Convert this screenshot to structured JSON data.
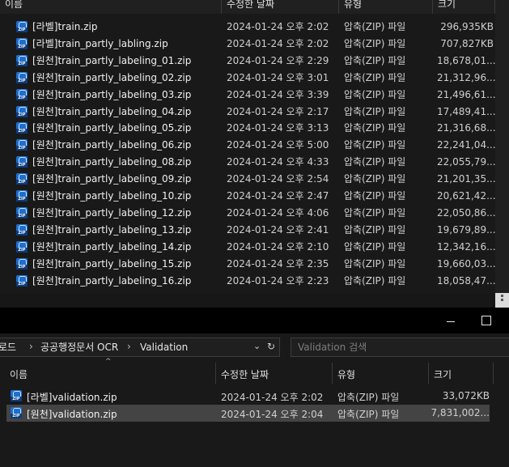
{
  "top_window": {
    "columns": {
      "name": "이름",
      "date": "수정한 날짜",
      "type": "유형",
      "size": "크기"
    },
    "files": [
      {
        "name": "[라벨]train.zip",
        "date": "2024-01-24 오후 2:02",
        "type": "압축(ZIP) 파일",
        "size": "296,935KB"
      },
      {
        "name": "[라벨]train_partly_labling.zip",
        "date": "2024-01-24 오후 2:02",
        "type": "압축(ZIP) 파일",
        "size": "707,827KB"
      },
      {
        "name": "[원천]train_partly_labeling_01.zip",
        "date": "2024-01-24 오후 2:29",
        "type": "압축(ZIP) 파일",
        "size": "18,678,01..."
      },
      {
        "name": "[원천]train_partly_labeling_02.zip",
        "date": "2024-01-24 오후 3:01",
        "type": "압축(ZIP) 파일",
        "size": "21,312,96..."
      },
      {
        "name": "[원천]train_partly_labeling_03.zip",
        "date": "2024-01-24 오후 3:39",
        "type": "압축(ZIP) 파일",
        "size": "21,496,61..."
      },
      {
        "name": "[원천]train_partly_labeling_04.zip",
        "date": "2024-01-24 오후 2:17",
        "type": "압축(ZIP) 파일",
        "size": "17,489,41..."
      },
      {
        "name": "[원천]train_partly_labeling_05.zip",
        "date": "2024-01-24 오후 3:13",
        "type": "압축(ZIP) 파일",
        "size": "21,316,68..."
      },
      {
        "name": "[원천]train_partly_labeling_06.zip",
        "date": "2024-01-24 오후 5:00",
        "type": "압축(ZIP) 파일",
        "size": "22,241,04..."
      },
      {
        "name": "[원천]train_partly_labeling_08.zip",
        "date": "2024-01-24 오후 4:33",
        "type": "압축(ZIP) 파일",
        "size": "22,055,79..."
      },
      {
        "name": "[원천]train_partly_labeling_09.zip",
        "date": "2024-01-24 오후 2:54",
        "type": "압축(ZIP) 파일",
        "size": "21,201,35..."
      },
      {
        "name": "[원천]train_partly_labeling_10.zip",
        "date": "2024-01-24 오후 2:47",
        "type": "압축(ZIP) 파일",
        "size": "20,621,42..."
      },
      {
        "name": "[원천]train_partly_labeling_12.zip",
        "date": "2024-01-24 오후 4:06",
        "type": "압축(ZIP) 파일",
        "size": "22,050,86..."
      },
      {
        "name": "[원천]train_partly_labeling_13.zip",
        "date": "2024-01-24 오후 2:41",
        "type": "압축(ZIP) 파일",
        "size": "19,679,89..."
      },
      {
        "name": "[원천]train_partly_labeling_14.zip",
        "date": "2024-01-24 오후 2:10",
        "type": "압축(ZIP) 파일",
        "size": "12,342,16..."
      },
      {
        "name": "[원천]train_partly_labeling_15.zip",
        "date": "2024-01-24 오후 2:35",
        "type": "압축(ZIP) 파일",
        "size": "19,660,03..."
      },
      {
        "name": "[원천]train_partly_labeling_16.zip",
        "date": "2024-01-24 오후 2:23",
        "type": "압축(ZIP) 파일",
        "size": "18,058,47..."
      }
    ]
  },
  "bottom_window": {
    "breadcrumb": [
      "로드",
      "공공행정문서 OCR",
      "Validation"
    ],
    "search_placeholder": "Validation 검색",
    "columns": {
      "name": "이름",
      "date": "수정한 날짜",
      "type": "유형",
      "size": "크기"
    },
    "files": [
      {
        "name": "[라벨]validation.zip",
        "date": "2024-01-24 오후 2:02",
        "type": "압축(ZIP) 파일",
        "size": "33,072KB",
        "selected": false
      },
      {
        "name": "[원천]validation.zip",
        "date": "2024-01-24 오후 2:04",
        "type": "압축(ZIP) 파일",
        "size": "7,831,002...",
        "selected": true
      }
    ]
  }
}
